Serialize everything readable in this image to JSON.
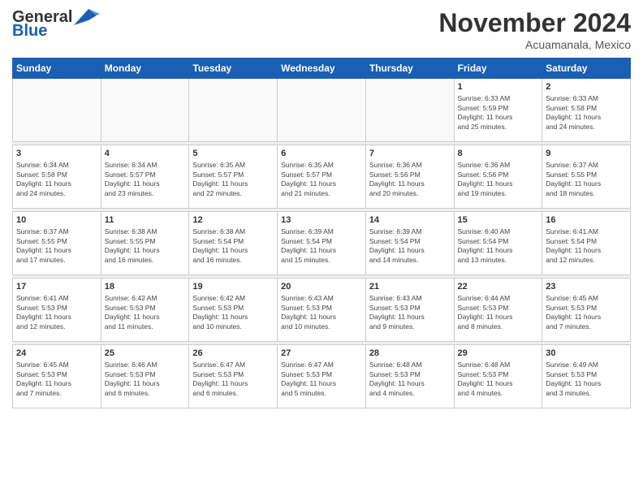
{
  "header": {
    "logo_general": "General",
    "logo_blue": "Blue",
    "month_title": "November 2024",
    "location": "Acuamanala, Mexico"
  },
  "weekdays": [
    "Sunday",
    "Monday",
    "Tuesday",
    "Wednesday",
    "Thursday",
    "Friday",
    "Saturday"
  ],
  "weeks": [
    [
      {
        "day": "",
        "info": ""
      },
      {
        "day": "",
        "info": ""
      },
      {
        "day": "",
        "info": ""
      },
      {
        "day": "",
        "info": ""
      },
      {
        "day": "",
        "info": ""
      },
      {
        "day": "1",
        "info": "Sunrise: 6:33 AM\nSunset: 5:59 PM\nDaylight: 11 hours\nand 25 minutes."
      },
      {
        "day": "2",
        "info": "Sunrise: 6:33 AM\nSunset: 5:58 PM\nDaylight: 11 hours\nand 24 minutes."
      }
    ],
    [
      {
        "day": "3",
        "info": "Sunrise: 6:34 AM\nSunset: 5:58 PM\nDaylight: 11 hours\nand 24 minutes."
      },
      {
        "day": "4",
        "info": "Sunrise: 6:34 AM\nSunset: 5:57 PM\nDaylight: 11 hours\nand 23 minutes."
      },
      {
        "day": "5",
        "info": "Sunrise: 6:35 AM\nSunset: 5:57 PM\nDaylight: 11 hours\nand 22 minutes."
      },
      {
        "day": "6",
        "info": "Sunrise: 6:35 AM\nSunset: 5:57 PM\nDaylight: 11 hours\nand 21 minutes."
      },
      {
        "day": "7",
        "info": "Sunrise: 6:36 AM\nSunset: 5:56 PM\nDaylight: 11 hours\nand 20 minutes."
      },
      {
        "day": "8",
        "info": "Sunrise: 6:36 AM\nSunset: 5:56 PM\nDaylight: 11 hours\nand 19 minutes."
      },
      {
        "day": "9",
        "info": "Sunrise: 6:37 AM\nSunset: 5:55 PM\nDaylight: 11 hours\nand 18 minutes."
      }
    ],
    [
      {
        "day": "10",
        "info": "Sunrise: 6:37 AM\nSunset: 5:55 PM\nDaylight: 11 hours\nand 17 minutes."
      },
      {
        "day": "11",
        "info": "Sunrise: 6:38 AM\nSunset: 5:55 PM\nDaylight: 11 hours\nand 16 minutes."
      },
      {
        "day": "12",
        "info": "Sunrise: 6:38 AM\nSunset: 5:54 PM\nDaylight: 11 hours\nand 16 minutes."
      },
      {
        "day": "13",
        "info": "Sunrise: 6:39 AM\nSunset: 5:54 PM\nDaylight: 11 hours\nand 15 minutes."
      },
      {
        "day": "14",
        "info": "Sunrise: 6:39 AM\nSunset: 5:54 PM\nDaylight: 11 hours\nand 14 minutes."
      },
      {
        "day": "15",
        "info": "Sunrise: 6:40 AM\nSunset: 5:54 PM\nDaylight: 11 hours\nand 13 minutes."
      },
      {
        "day": "16",
        "info": "Sunrise: 6:41 AM\nSunset: 5:54 PM\nDaylight: 11 hours\nand 12 minutes."
      }
    ],
    [
      {
        "day": "17",
        "info": "Sunrise: 6:41 AM\nSunset: 5:53 PM\nDaylight: 11 hours\nand 12 minutes."
      },
      {
        "day": "18",
        "info": "Sunrise: 6:42 AM\nSunset: 5:53 PM\nDaylight: 11 hours\nand 11 minutes."
      },
      {
        "day": "19",
        "info": "Sunrise: 6:42 AM\nSunset: 5:53 PM\nDaylight: 11 hours\nand 10 minutes."
      },
      {
        "day": "20",
        "info": "Sunrise: 6:43 AM\nSunset: 5:53 PM\nDaylight: 11 hours\nand 10 minutes."
      },
      {
        "day": "21",
        "info": "Sunrise: 6:43 AM\nSunset: 5:53 PM\nDaylight: 11 hours\nand 9 minutes."
      },
      {
        "day": "22",
        "info": "Sunrise: 6:44 AM\nSunset: 5:53 PM\nDaylight: 11 hours\nand 8 minutes."
      },
      {
        "day": "23",
        "info": "Sunrise: 6:45 AM\nSunset: 5:53 PM\nDaylight: 11 hours\nand 7 minutes."
      }
    ],
    [
      {
        "day": "24",
        "info": "Sunrise: 6:45 AM\nSunset: 5:53 PM\nDaylight: 11 hours\nand 7 minutes."
      },
      {
        "day": "25",
        "info": "Sunrise: 6:46 AM\nSunset: 5:53 PM\nDaylight: 11 hours\nand 6 minutes."
      },
      {
        "day": "26",
        "info": "Sunrise: 6:47 AM\nSunset: 5:53 PM\nDaylight: 11 hours\nand 6 minutes."
      },
      {
        "day": "27",
        "info": "Sunrise: 6:47 AM\nSunset: 5:53 PM\nDaylight: 11 hours\nand 5 minutes."
      },
      {
        "day": "28",
        "info": "Sunrise: 6:48 AM\nSunset: 5:53 PM\nDaylight: 11 hours\nand 4 minutes."
      },
      {
        "day": "29",
        "info": "Sunrise: 6:48 AM\nSunset: 5:53 PM\nDaylight: 11 hours\nand 4 minutes."
      },
      {
        "day": "30",
        "info": "Sunrise: 6:49 AM\nSunset: 5:53 PM\nDaylight: 11 hours\nand 3 minutes."
      }
    ]
  ]
}
